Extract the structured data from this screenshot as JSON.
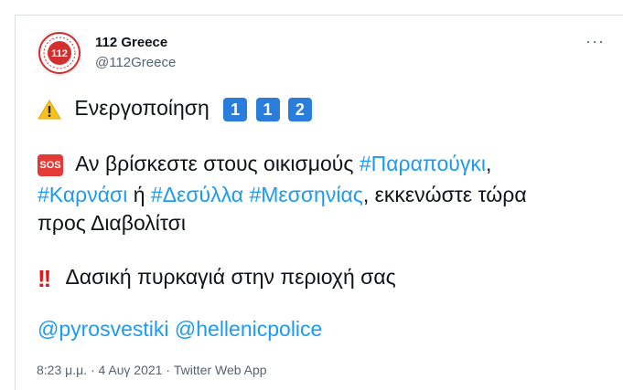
{
  "account": {
    "name": "112 Greece",
    "handle": "@112Greece",
    "avatar_text": "112",
    "avatar_color": "#d32f2f"
  },
  "more_label": "···",
  "tweet": {
    "line1_text": "Ενεργοποίηση",
    "digits": [
      "1",
      "1",
      "2"
    ],
    "sos_label": "SOS",
    "line2_pre": "Αν βρίσκεστε στους οικισμούς",
    "hashtag1": "#Παραπούγκι",
    "line2_comma": ",",
    "hashtag2": "#Καρνάσι",
    "conj": "ή",
    "hashtag3": "#Δεσύλλα",
    "hashtag4": "#Μεσσηνίας",
    "line3_post": ", εκκενώστε τώρα",
    "line4": "προς Διαβολίτσι",
    "line5": "Δασική πυρκαγιά στην περιοχή σας",
    "mention1": "@pyrosvestiki",
    "mention2": "@hellenicpolice"
  },
  "meta": {
    "time": "8:23 μ.μ.",
    "sep": "·",
    "date": "4 Αυγ 2021",
    "source": "Twitter Web App"
  },
  "colors": {
    "link": "#1d9bf0",
    "digit_box": "#2a7ddb",
    "sos": "#e53935",
    "warning": "#f7c21b"
  },
  "icons": [
    "warning-icon",
    "sos-icon",
    "double-exclamation-icon",
    "more-icon"
  ]
}
